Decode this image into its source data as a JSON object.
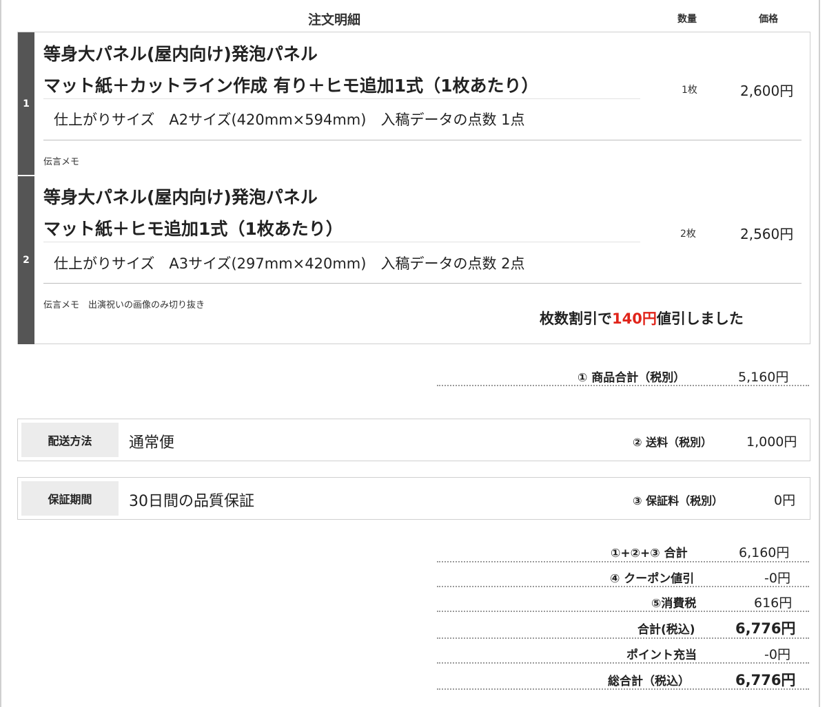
{
  "header": {
    "title": "注文明細",
    "quantity": "数量",
    "price": "価格"
  },
  "items": [
    {
      "number": "1",
      "title_line1": "等身大パネル(屋内向け)発泡パネル",
      "title_line2": "マット紙＋カットライン作成 有り＋ヒモ追加1式（1枚あたり）",
      "spec": "仕上がりサイズ　A2サイズ(420mm×594mm)　入稿データの点数  1点",
      "quantity": "1枚",
      "price": "2,600円",
      "memo": "伝言メモ"
    },
    {
      "number": "2",
      "title_line1": "等身大パネル(屋内向け)発泡パネル",
      "title_line2": "マット紙＋ヒモ追加1式（1枚あたり）",
      "spec": "仕上がりサイズ　A3サイズ(297mm×420mm)　入稿データの点数  2点",
      "quantity": "2枚",
      "price": "2,560円",
      "memo": "伝言メモ　出演祝いの画像のみ切り抜き"
    }
  ],
  "discount": {
    "prefix": "枚数割引で",
    "amount": "140円",
    "suffix": "値引しました",
    "highlight_color": "#e0241a"
  },
  "subtotal": {
    "label": "① 商品合計（税別）",
    "value": "5,160円"
  },
  "shipping": {
    "label": "配送方法",
    "value": "通常便",
    "sum_label": "② 送料（税別）",
    "sum_value": "1,000円"
  },
  "warranty": {
    "label": "保証期間",
    "value": "30日間の品質保証",
    "sum_label": "③ 保証料（税別）",
    "sum_value": "0円"
  },
  "totals": [
    {
      "label": "①+②+③ 合計",
      "value": "6,160円"
    },
    {
      "label": "④ クーポン値引",
      "value": "-0円"
    },
    {
      "label": "⑤消費税",
      "value": "616円"
    },
    {
      "label": "合計(税込)",
      "value": "6,776円"
    },
    {
      "label": "ポイント充当",
      "value": "-0円"
    },
    {
      "label": "総合計（税込）",
      "value": "6,776円"
    }
  ]
}
